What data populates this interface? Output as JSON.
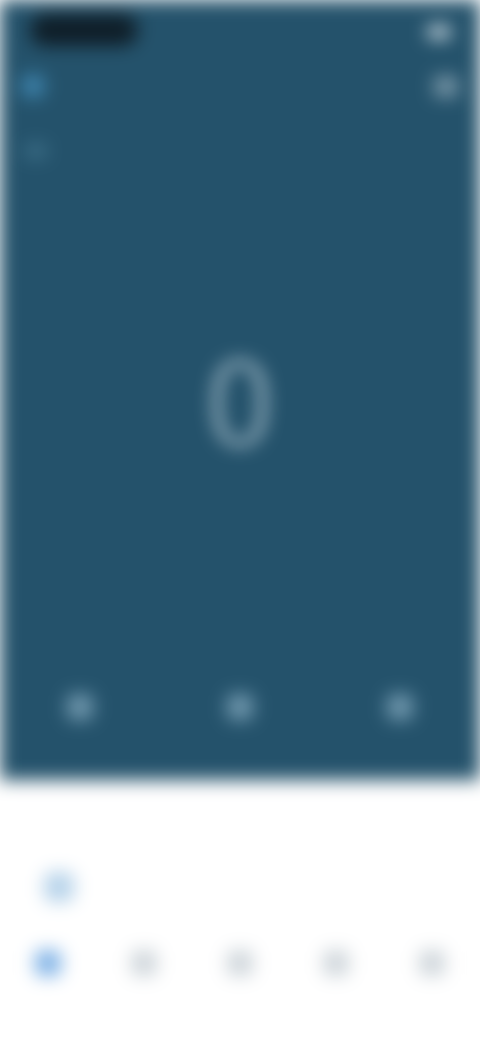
{
  "status_bar": {
    "pill_text": "",
    "right_text": ""
  },
  "header": {
    "title": "",
    "logo_icon": "app-logo-icon",
    "menu_icon": "menu-icon"
  },
  "tabs": [
    {
      "label": ""
    },
    {
      "label": ""
    },
    {
      "label": ""
    },
    {
      "label": ""
    },
    {
      "label": ""
    }
  ],
  "main": {
    "subtitle": "",
    "count_value": "0",
    "count_label": "",
    "mid_label": ""
  },
  "quick_actions": [
    {
      "label": ""
    },
    {
      "label": ""
    },
    {
      "label": ""
    }
  ],
  "section": {
    "title": "",
    "item_label": ""
  },
  "bottom_nav": [
    {
      "label": ""
    },
    {
      "label": ""
    },
    {
      "label": ""
    },
    {
      "label": ""
    },
    {
      "label": ""
    }
  ],
  "colors": {
    "top_bg": "#24526b",
    "accent": "#3a7cc7",
    "bottom_bg": "#ffffff"
  }
}
